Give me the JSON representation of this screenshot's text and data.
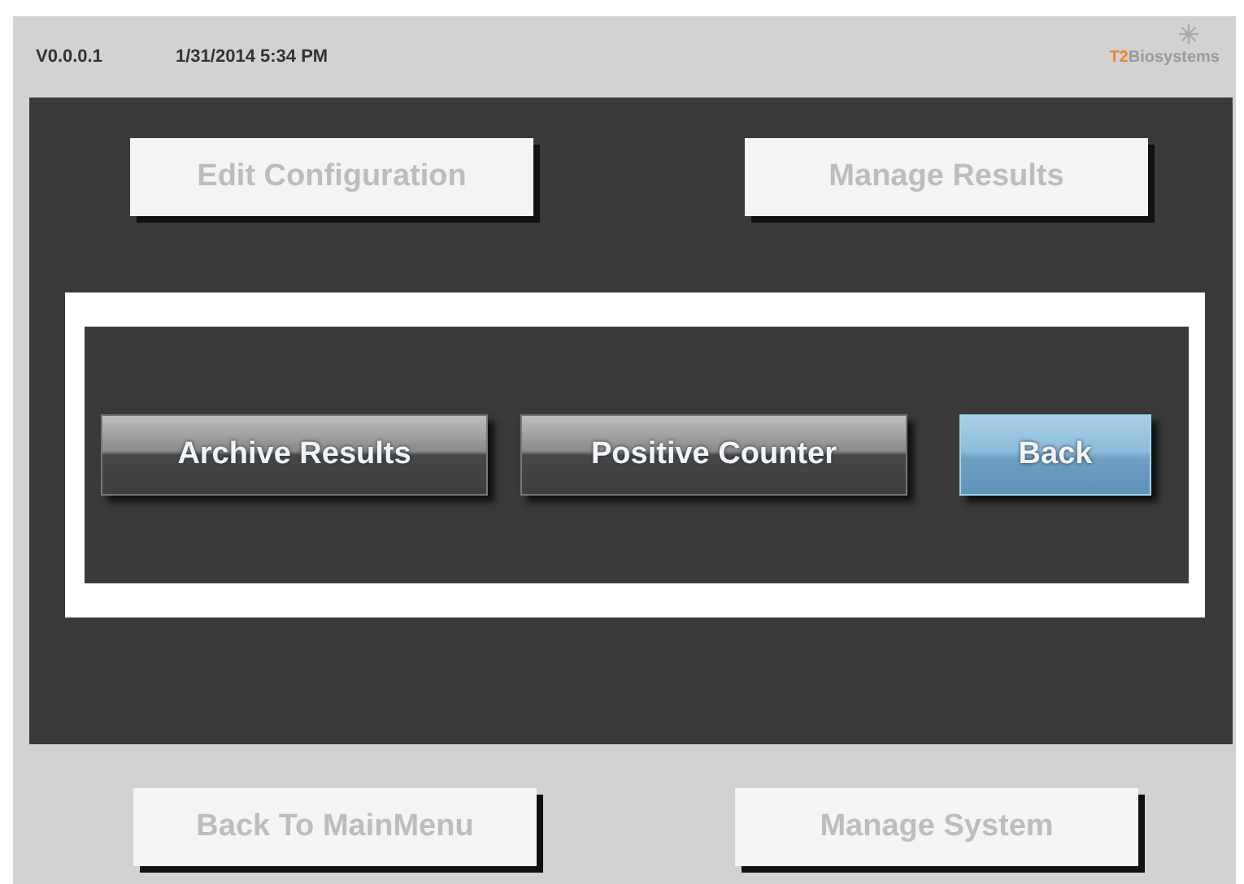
{
  "header": {
    "version": "V0.0.0.1",
    "datetime": "1/31/2014 5:34 PM",
    "logo": {
      "mark": "T2",
      "text": "Biosystems"
    }
  },
  "top_buttons": [
    {
      "label": "Edit Configuration",
      "disabled": true
    },
    {
      "label": "Manage Results",
      "disabled": true
    }
  ],
  "dialog": {
    "buttons": [
      {
        "label": "Archive Results",
        "highlighted": false
      },
      {
        "label": "Positive Counter",
        "highlighted": false
      },
      {
        "label": "Back",
        "highlighted": true
      }
    ]
  },
  "bottom_buttons": [
    {
      "label": "Back To MainMenu",
      "disabled": true
    },
    {
      "label": "Manage System",
      "disabled": true
    }
  ]
}
